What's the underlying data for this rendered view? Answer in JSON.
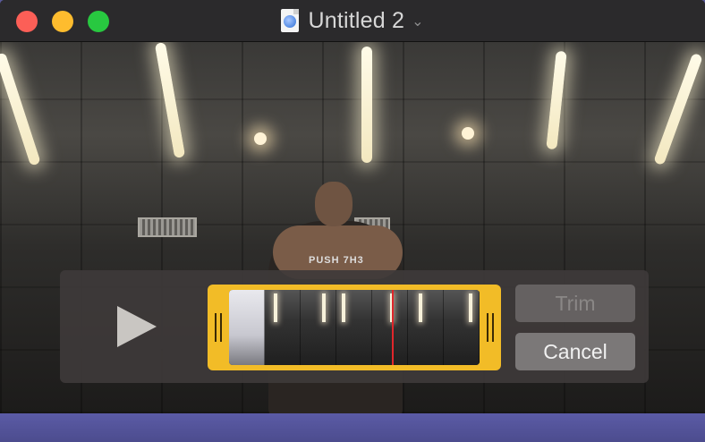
{
  "window": {
    "title": "Untitled 2",
    "title_chevron": "⌄"
  },
  "icons": {
    "document": "quicktime-movie-icon",
    "play": "play-icon"
  },
  "trim": {
    "trim_label": "Trim",
    "cancel_label": "Cancel",
    "accent_color": "#f2bc27",
    "playhead_color": "#e0262b"
  },
  "video": {
    "shirt_text": "PUSH 7H3"
  }
}
